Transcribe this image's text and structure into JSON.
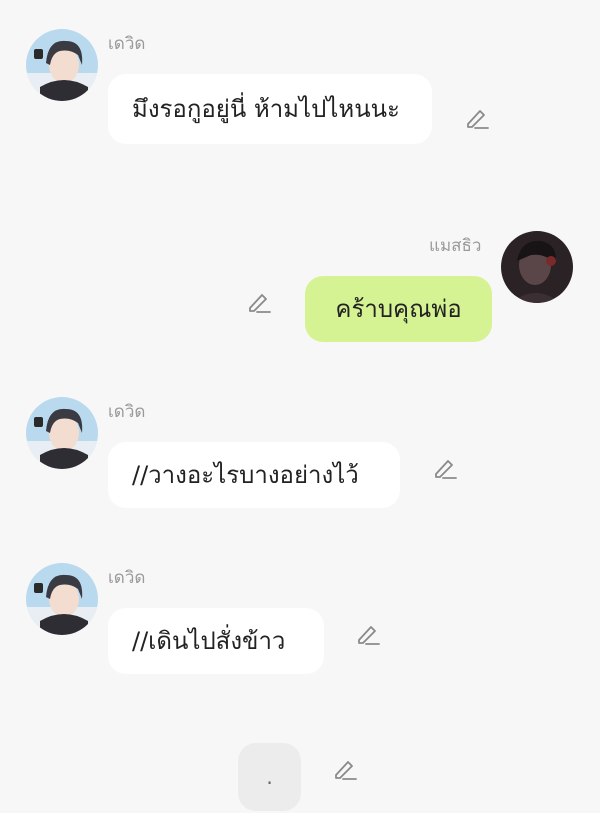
{
  "messages": [
    {
      "sender": "เดวิด",
      "text": "มึงรอกูอยู่นี่ ห้ามไปไหนนะ"
    },
    {
      "sender": "แมสธิว",
      "text": "คร้าบคุณพ่อ"
    },
    {
      "sender": "เดวิด",
      "text": "//วางอะไรบางอย่างไว้"
    },
    {
      "sender": "เดวิด",
      "text": "//เดินไปสั่งข้าว"
    },
    {
      "text": "."
    }
  ],
  "colors": {
    "background": "#f7f7f7",
    "bubble_other": "#ffffff",
    "bubble_mine": "#d6f394",
    "sender_text": "#9a9a9a",
    "edit_icon": "#8a8a8a"
  },
  "icons": {
    "edit": "pencil-edit-icon",
    "avatar_other": "anime-boy-avatar",
    "avatar_mine": "dark-portrait-avatar"
  }
}
